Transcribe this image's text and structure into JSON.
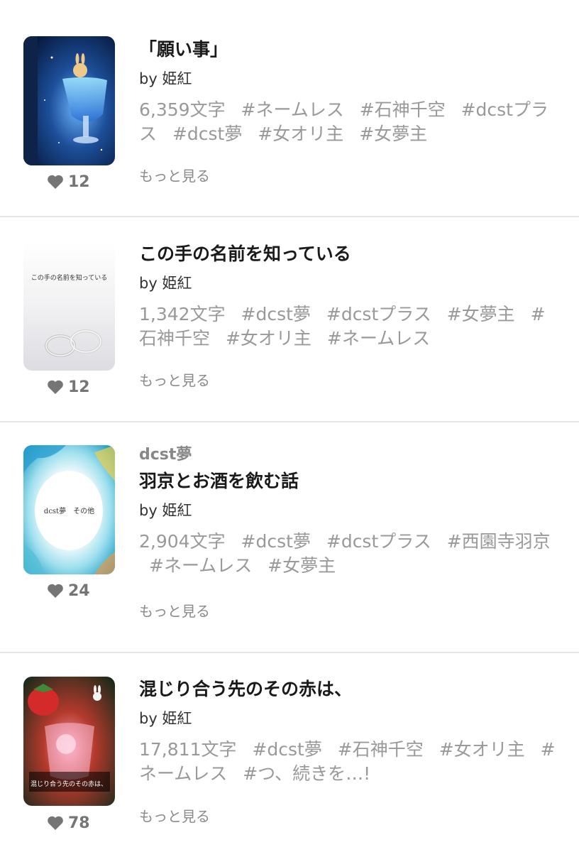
{
  "works": [
    {
      "series": "",
      "title": "「願い事」",
      "author": "by 姫紅",
      "char_count": "6,359文字",
      "tags": [
        "#ネームレス",
        "#石神千空",
        "#dcstプラス",
        "#dcst夢",
        "#女オリ主",
        "#女夢主"
      ],
      "more": "もっと見る",
      "likes": "12",
      "cover_text": ""
    },
    {
      "series": "",
      "title": "この手の名前を知っている",
      "author": "by 姫紅",
      "char_count": "1,342文字",
      "tags": [
        "#dcst夢",
        "#dcstプラス",
        "#女夢主",
        "#石神千空",
        "#女オリ主",
        "#ネームレス"
      ],
      "more": "もっと見る",
      "likes": "12",
      "cover_text": "この手の名前を知っている"
    },
    {
      "series": "dcst夢",
      "title": "羽京とお酒を飲む話",
      "author": "by 姫紅",
      "char_count": "2,904文字",
      "tags": [
        "#dcst夢",
        "#dcstプラス",
        "#西園寺羽京",
        "#ネームレス",
        "#女夢主"
      ],
      "more": "もっと見る",
      "likes": "24",
      "cover_text": "dcst夢　その他"
    },
    {
      "series": "",
      "title": "混じり合う先のその赤は、",
      "author": "by 姫紅",
      "char_count": "17,811文字",
      "tags": [
        "#dcst夢",
        "#石神千空",
        "#女オリ主",
        "#ネームレス",
        "#つ、続きを…!"
      ],
      "more": "もっと見る",
      "likes": "78",
      "cover_text": "混じり合う先のその赤は、"
    }
  ],
  "colors": {
    "text_primary": "#1a1a1a",
    "text_secondary": "#999999",
    "divider": "#e6e6e6",
    "heart": "#757575"
  }
}
